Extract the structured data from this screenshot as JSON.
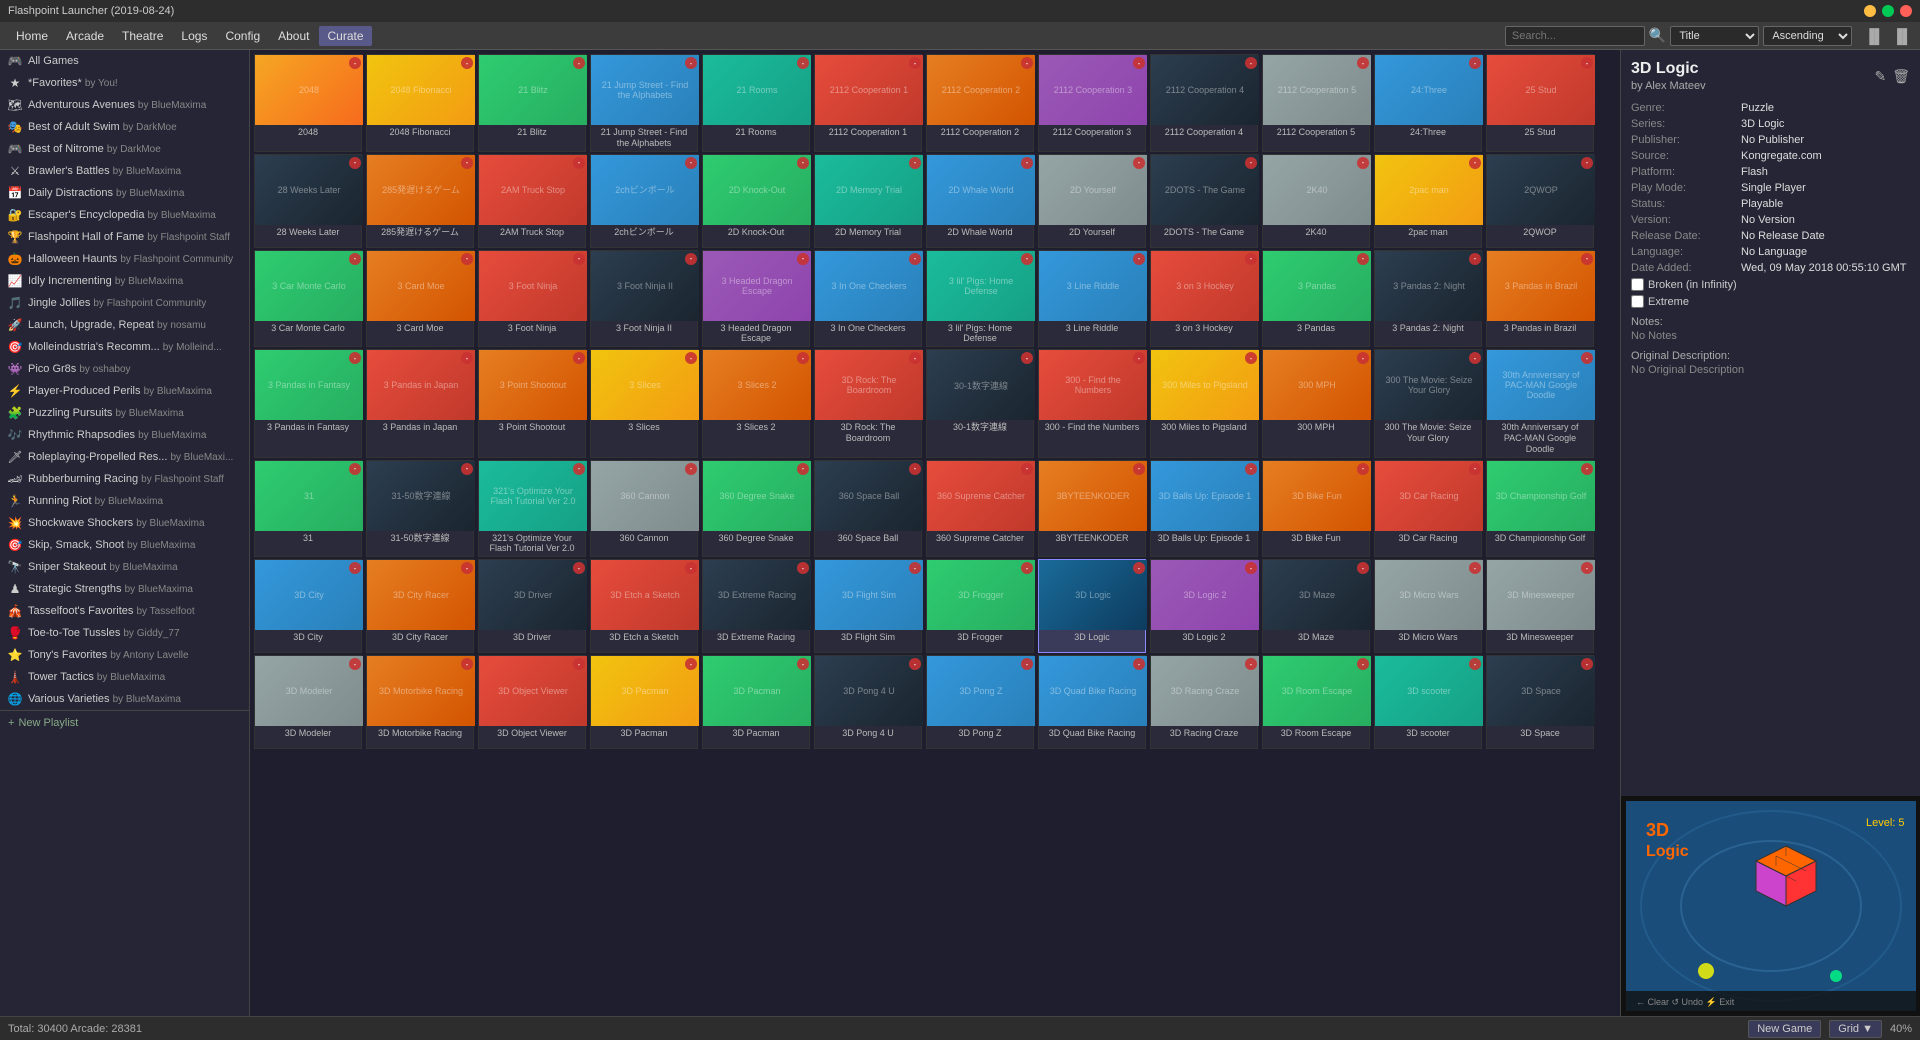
{
  "app": {
    "title": "Flashpoint Launcher (2019-08-24)",
    "window_controls": [
      "minimize",
      "maximize",
      "close"
    ]
  },
  "menubar": {
    "items": [
      "Home",
      "Arcade",
      "Theatre",
      "Logs",
      "Config",
      "About",
      "Curate"
    ],
    "active": "Curate",
    "search_placeholder": "Search...",
    "sort_field": "Title",
    "sort_order": "Ascending",
    "toolbar_icons": [
      "▐▌",
      "▐▌"
    ]
  },
  "sidebar": {
    "top_item": "All Games",
    "items": [
      {
        "id": "favorites",
        "icon": "★",
        "label": "*Favorites*",
        "by": "by You!"
      },
      {
        "id": "adventurous-avenues",
        "icon": "🗺",
        "label": "Adventurous Avenues",
        "by": "by BlueMaxima"
      },
      {
        "id": "best-adult-swim",
        "icon": "🎭",
        "label": "Best of Adult Swim",
        "by": "by DarkMoe"
      },
      {
        "id": "best-nitrome",
        "icon": "🎮",
        "label": "Best of Nitrome",
        "by": "by DarkMoe"
      },
      {
        "id": "brawlers-battles",
        "icon": "⚔",
        "label": "Brawler's Battles",
        "by": "by BlueMaxima"
      },
      {
        "id": "daily-distractions",
        "icon": "📅",
        "label": "Daily Distractions",
        "by": "by BlueMaxima"
      },
      {
        "id": "escapers-encyclopedia",
        "icon": "🔐",
        "label": "Escaper's Encyclopedia",
        "by": "by BlueMaxima"
      },
      {
        "id": "flashpoint-hall-of-fame",
        "icon": "🏆",
        "label": "Flashpoint Hall of Fame",
        "by": "by Flashpoint Staff"
      },
      {
        "id": "halloween-haunts",
        "icon": "🎃",
        "label": "Halloween Haunts",
        "by": "by Flashpoint Community"
      },
      {
        "id": "idly-incrementing",
        "icon": "📈",
        "label": "Idly Incrementing",
        "by": "by BlueMaxima"
      },
      {
        "id": "jingle-jollies",
        "icon": "🎵",
        "label": "Jingle Jollies",
        "by": "by Flashpoint Community"
      },
      {
        "id": "launch-upgrade-repeat",
        "icon": "🚀",
        "label": "Launch, Upgrade, Repeat",
        "by": "by nosamu"
      },
      {
        "id": "molleindustrias",
        "icon": "🎯",
        "label": "Molleindustria's Recomm...",
        "by": "by Molleind..."
      },
      {
        "id": "pico-gr8s",
        "icon": "👾",
        "label": "Pico Gr8s",
        "by": "by oshaboy"
      },
      {
        "id": "player-produced-perils",
        "icon": "⚡",
        "label": "Player-Produced Perils",
        "by": "by BlueMaxima"
      },
      {
        "id": "puzzling-pursuits",
        "icon": "🧩",
        "label": "Puzzling Pursuits",
        "by": "by BlueMaxima"
      },
      {
        "id": "rhythmic-rhapsodies",
        "icon": "🎶",
        "label": "Rhythmic Rhapsodies",
        "by": "by BlueMaxima"
      },
      {
        "id": "roleplaying-propelled",
        "icon": "🗡",
        "label": "Roleplaying-Propelled Res...",
        "by": "by BlueMaxi..."
      },
      {
        "id": "rubberburning-racing",
        "icon": "🏎",
        "label": "Rubberburning Racing",
        "by": "by Flashpoint Staff"
      },
      {
        "id": "running-riot",
        "icon": "🏃",
        "label": "Running Riot",
        "by": "by BlueMaxima"
      },
      {
        "id": "shockwave-shockers",
        "icon": "💥",
        "label": "Shockwave Shockers",
        "by": "by BlueMaxima"
      },
      {
        "id": "skip-smack-shoot",
        "icon": "🎯",
        "label": "Skip, Smack, Shoot",
        "by": "by BlueMaxima"
      },
      {
        "id": "sniper-stakeout",
        "icon": "🔭",
        "label": "Sniper Stakeout",
        "by": "by BlueMaxima"
      },
      {
        "id": "strategic-strengths",
        "icon": "♟",
        "label": "Strategic Strengths",
        "by": "by BlueMaxima"
      },
      {
        "id": "tasselfoots-favorites",
        "icon": "🎪",
        "label": "Tasselfoot's Favorites",
        "by": "by Tasselfoot"
      },
      {
        "id": "toe-to-toe-tussles",
        "icon": "🥊",
        "label": "Toe-to-Toe Tussles",
        "by": "by Giddy_77"
      },
      {
        "id": "tonys-favorites",
        "icon": "⭐",
        "label": "Tony's Favorites",
        "by": "by Antony Lavelle"
      },
      {
        "id": "tower-tactics",
        "icon": "🗼",
        "label": "Tower Tactics",
        "by": "by BlueMaxima"
      },
      {
        "id": "various-varieties",
        "icon": "🌐",
        "label": "Various Varieties",
        "by": "by BlueMaxima"
      }
    ],
    "new_playlist": "New Playlist"
  },
  "games": [
    {
      "id": "g1",
      "label": "2048",
      "color": "thumb-2048"
    },
    {
      "id": "g2",
      "label": "2048 Fibonacci",
      "color": "thumb-yellow"
    },
    {
      "id": "g3",
      "label": "21 Blitz",
      "color": "thumb-green"
    },
    {
      "id": "g4",
      "label": "21 Jump Street - Find the Alphabets",
      "color": "thumb-blue"
    },
    {
      "id": "g5",
      "label": "21 Rooms",
      "color": "thumb-teal"
    },
    {
      "id": "g6",
      "label": "2112 Cooperation 1",
      "color": "thumb-red"
    },
    {
      "id": "g7",
      "label": "2112 Cooperation 2",
      "color": "thumb-orange"
    },
    {
      "id": "g8",
      "label": "2112 Cooperation 3",
      "color": "thumb-purple"
    },
    {
      "id": "g9",
      "label": "2112 Cooperation 4",
      "color": "thumb-dark"
    },
    {
      "id": "g10",
      "label": "2112 Cooperation 5",
      "color": "thumb-gray"
    },
    {
      "id": "g11",
      "label": "24:Three",
      "color": "thumb-blue"
    },
    {
      "id": "g12",
      "label": "25 Stud",
      "color": "thumb-red"
    },
    {
      "id": "g13",
      "label": "28 Weeks Later",
      "color": "thumb-dark"
    },
    {
      "id": "g14",
      "label": "285発遅けるゲーム",
      "color": "thumb-orange"
    },
    {
      "id": "g15",
      "label": "2AM Truck Stop",
      "color": "thumb-red"
    },
    {
      "id": "g16",
      "label": "2chビンボール",
      "color": "thumb-blue"
    },
    {
      "id": "g17",
      "label": "2D Knock-Out",
      "color": "thumb-green"
    },
    {
      "id": "g18",
      "label": "2D Memory Trial",
      "color": "thumb-teal"
    },
    {
      "id": "g19",
      "label": "2D Whale World",
      "color": "thumb-blue"
    },
    {
      "id": "g20",
      "label": "2D Yourself",
      "color": "thumb-gray"
    },
    {
      "id": "g21",
      "label": "2DOTS - The Game",
      "color": "thumb-dark"
    },
    {
      "id": "g22",
      "label": "2K40",
      "color": "thumb-gray"
    },
    {
      "id": "g23",
      "label": "2pac man",
      "color": "thumb-yellow"
    },
    {
      "id": "g24",
      "label": "2QWOP",
      "color": "thumb-dark"
    },
    {
      "id": "g25",
      "label": "3 Car Monte Carlo",
      "color": "thumb-green"
    },
    {
      "id": "g26",
      "label": "3 Card Moe",
      "color": "thumb-orange"
    },
    {
      "id": "g27",
      "label": "3 Foot Ninja",
      "color": "thumb-red"
    },
    {
      "id": "g28",
      "label": "3 Foot Ninja II",
      "color": "thumb-dark"
    },
    {
      "id": "g29",
      "label": "3 Headed Dragon Escape",
      "color": "thumb-purple"
    },
    {
      "id": "g30",
      "label": "3 In One Checkers",
      "color": "thumb-blue"
    },
    {
      "id": "g31",
      "label": "3 lil' Pigs: Home Defense",
      "color": "thumb-teal"
    },
    {
      "id": "g32",
      "label": "3 Line Riddle",
      "color": "thumb-blue"
    },
    {
      "id": "g33",
      "label": "3 on 3 Hockey",
      "color": "thumb-red"
    },
    {
      "id": "g34",
      "label": "3 Pandas",
      "color": "thumb-green"
    },
    {
      "id": "g35",
      "label": "3 Pandas 2: Night",
      "color": "thumb-dark"
    },
    {
      "id": "g36",
      "label": "3 Pandas in Brazil",
      "color": "thumb-orange"
    },
    {
      "id": "g37",
      "label": "3 Pandas in Fantasy",
      "color": "thumb-green"
    },
    {
      "id": "g38",
      "label": "3 Pandas in Japan",
      "color": "thumb-red"
    },
    {
      "id": "g39",
      "label": "3 Point Shootout",
      "color": "thumb-orange"
    },
    {
      "id": "g40",
      "label": "3 Slices",
      "color": "thumb-yellow"
    },
    {
      "id": "g41",
      "label": "3 Slices 2",
      "color": "thumb-orange"
    },
    {
      "id": "g42",
      "label": "3D Rock: The Boardroom",
      "color": "thumb-red"
    },
    {
      "id": "g43",
      "label": "30-1数字連線",
      "color": "thumb-dark"
    },
    {
      "id": "g44",
      "label": "300 - Find the Numbers",
      "color": "thumb-red"
    },
    {
      "id": "g45",
      "label": "300 Miles to Pigsland",
      "color": "thumb-yellow"
    },
    {
      "id": "g46",
      "label": "300 MPH",
      "color": "thumb-orange"
    },
    {
      "id": "g47",
      "label": "300 The Movie: Seize Your Glory",
      "color": "thumb-dark"
    },
    {
      "id": "g48",
      "label": "30th Anniversary of PAC-MAN Google Doodle",
      "color": "thumb-blue"
    },
    {
      "id": "g49",
      "label": "31",
      "color": "thumb-green"
    },
    {
      "id": "g50",
      "label": "31-50数字連線",
      "color": "thumb-dark"
    },
    {
      "id": "g51",
      "label": "321's Optimize Your Flash Tutorial Ver 2.0",
      "color": "thumb-teal"
    },
    {
      "id": "g52",
      "label": "360 Cannon",
      "color": "thumb-gray"
    },
    {
      "id": "g53",
      "label": "360 Degree Snake",
      "color": "thumb-green"
    },
    {
      "id": "g54",
      "label": "360 Space Ball",
      "color": "thumb-dark"
    },
    {
      "id": "g55",
      "label": "360 Supreme Catcher",
      "color": "thumb-red"
    },
    {
      "id": "g56",
      "label": "3BYTEENKODER",
      "color": "thumb-orange"
    },
    {
      "id": "g57",
      "label": "3D Balls Up: Episode 1",
      "color": "thumb-blue"
    },
    {
      "id": "g58",
      "label": "3D Bike Fun",
      "color": "thumb-orange"
    },
    {
      "id": "g59",
      "label": "3D Car Racing",
      "color": "thumb-red"
    },
    {
      "id": "g60",
      "label": "3D Championship Golf",
      "color": "thumb-green"
    },
    {
      "id": "g61",
      "label": "3D City",
      "color": "thumb-blue"
    },
    {
      "id": "g62",
      "label": "3D City Racer",
      "color": "thumb-orange"
    },
    {
      "id": "g63",
      "label": "3D Driver",
      "color": "thumb-dark"
    },
    {
      "id": "g64",
      "label": "3D Etch a Sketch",
      "color": "thumb-red"
    },
    {
      "id": "g65",
      "label": "3D Extreme Racing",
      "color": "thumb-dark"
    },
    {
      "id": "g66",
      "label": "3D Flight Sim",
      "color": "thumb-blue"
    },
    {
      "id": "g67",
      "label": "3D Frogger",
      "color": "thumb-green"
    },
    {
      "id": "g68",
      "label": "3D Logic",
      "color": "thumb-3dlogic",
      "selected": true
    },
    {
      "id": "g69",
      "label": "3D Logic 2",
      "color": "thumb-purple"
    },
    {
      "id": "g70",
      "label": "3D Maze",
      "color": "thumb-dark"
    },
    {
      "id": "g71",
      "label": "3D Micro Wars",
      "color": "thumb-gray"
    },
    {
      "id": "g72",
      "label": "3D Minesweeper",
      "color": "thumb-gray"
    },
    {
      "id": "g73",
      "label": "3D Modeler",
      "color": "thumb-gray"
    },
    {
      "id": "g74",
      "label": "3D Motorbike Racing",
      "color": "thumb-orange"
    },
    {
      "id": "g75",
      "label": "3D Object Viewer",
      "color": "thumb-red"
    },
    {
      "id": "g76",
      "label": "3D Pacman",
      "color": "thumb-yellow"
    },
    {
      "id": "g77",
      "label": "3D Pacman",
      "color": "thumb-green"
    },
    {
      "id": "g78",
      "label": "3D Pong 4 U",
      "color": "thumb-dark"
    },
    {
      "id": "g79",
      "label": "3D Pong Z",
      "color": "thumb-blue"
    },
    {
      "id": "g80",
      "label": "3D Quad Bike Racing",
      "color": "thumb-blue"
    },
    {
      "id": "g81",
      "label": "3D Racing Craze",
      "color": "thumb-gray"
    },
    {
      "id": "g82",
      "label": "3D Room Escape",
      "color": "thumb-green"
    },
    {
      "id": "g83",
      "label": "3D scooter",
      "color": "thumb-teal"
    },
    {
      "id": "g84",
      "label": "3D Space",
      "color": "thumb-dark"
    }
  ],
  "game_detail": {
    "title": "3D Logic",
    "author": "by Alex Mateev",
    "genre_label": "Genre:",
    "genre_value": "Puzzle",
    "series_label": "Series:",
    "series_value": "3D Logic",
    "publisher_label": "Publisher:",
    "publisher_value": "No Publisher",
    "source_label": "Source:",
    "source_value": "Kongregate.com",
    "platform_label": "Platform:",
    "platform_value": "Flash",
    "play_mode_label": "Play Mode:",
    "play_mode_value": "Single Player",
    "status_label": "Status:",
    "status_value": "Playable",
    "version_label": "Version:",
    "version_value": "No Version",
    "release_date_label": "Release Date:",
    "release_date_value": "No Release Date",
    "language_label": "Language:",
    "language_value": "No Language",
    "date_added_label": "Date Added:",
    "date_added_value": "Wed, 09 May 2018 00:55:10 GMT",
    "broken_label": "Broken (in Infinity)",
    "extreme_label": "Extreme",
    "notes_title": "Notes:",
    "notes_value": "No Notes",
    "original_description_title": "Original Description:",
    "original_description_value": "No Original Description",
    "edit_icon": "✎",
    "delete_icon": "🗑"
  },
  "statusbar": {
    "total_label": "Total: 30400 Arcade: 28381",
    "new_game_btn": "New Game",
    "grid_btn": "Grid ▼",
    "zoom_value": "40%"
  }
}
